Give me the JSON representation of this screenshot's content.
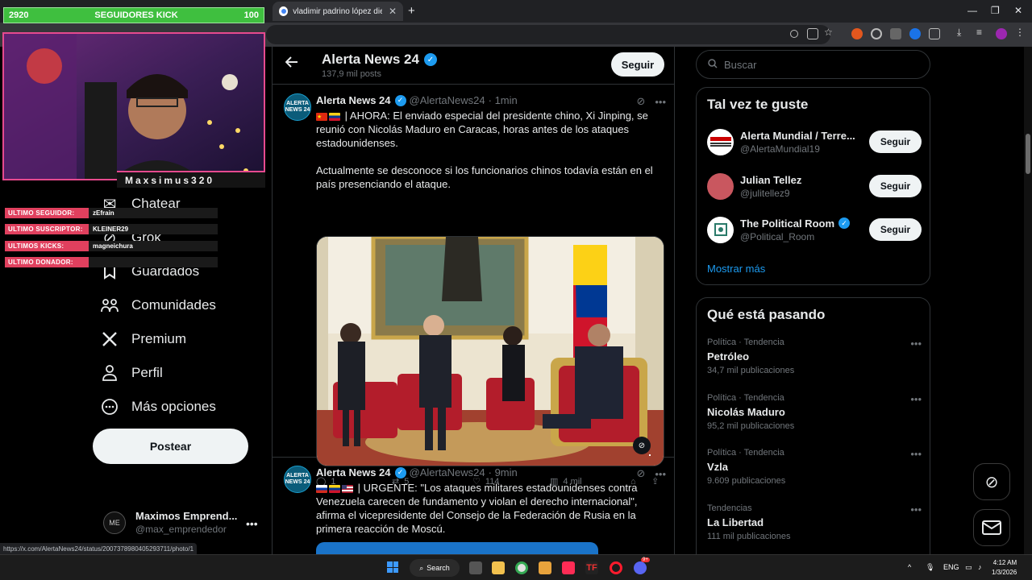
{
  "browser": {
    "active_tab_title": "vladimir padrino lópez died - G",
    "new_tab_symbol": "+",
    "url_status": "https://x.com/AlertaNews24/status/2007378980405293711/photo/1"
  },
  "stream_overlay": {
    "follower_count": "2920",
    "follower_title": "SEGUIDORES KICK",
    "follower_goal": "100",
    "streamer_name": "Maxsimus320",
    "rows": [
      {
        "label": "ULTIMO SEGUIDOR:",
        "value": "zEfrain"
      },
      {
        "label": "ULTIMO SUSCRIPTOR:",
        "value": "KLEINER29"
      },
      {
        "label": "ULTIMOS KICKS:",
        "value": "magneichura"
      },
      {
        "label": "ULTIMO DONADOR:",
        "value": ""
      }
    ]
  },
  "nav": {
    "items": [
      {
        "label": "Chatear",
        "icon": "chat-icon"
      },
      {
        "label": "Grok",
        "icon": "grok-icon"
      },
      {
        "label": "Guardados",
        "icon": "bookmark-icon"
      },
      {
        "label": "Comunidades",
        "icon": "communities-icon"
      },
      {
        "label": "Premium",
        "icon": "x-logo-icon"
      },
      {
        "label": "Perfil",
        "icon": "profile-icon"
      },
      {
        "label": "Más opciones",
        "icon": "more-options-icon"
      }
    ],
    "post_button": "Postear",
    "account": {
      "name": "Maximos Emprend...",
      "handle": "@max_emprendedor",
      "avatar_text": "ME"
    }
  },
  "profile_header": {
    "name": "Alerta News 24",
    "posts_count": "137,9 mil posts",
    "follow_label": "Seguir"
  },
  "tweets": [
    {
      "name": "Alerta News 24",
      "handle": "@AlertaNews24",
      "time": "· 1min",
      "avatar_text": "ALERTA NEWS 24",
      "text_p1": "| AHORA: El enviado especial del presidente chino, Xi Jinping, se reunió con Nicolás Maduro en Caracas, horas antes de los ataques estadounidenses.",
      "text_p2": "Actualmente se desconoce si los funcionarios chinos todavía están en el país presenciando el ataque.",
      "replies": "1",
      "reposts": "5",
      "likes": "114",
      "views": "4 mil"
    },
    {
      "name": "Alerta News 24",
      "handle": "@AlertaNews24",
      "time": "· 9min",
      "avatar_text": "ALERTA NEWS 24",
      "text_p1": "| URGENTE: \"Los ataques militares estadounidenses contra Venezuela carecen de fundamento y violan el derecho internacional\", afirma el vicepresidente del Consejo de la Federación de Rusia en la primera reacción de Moscú."
    }
  ],
  "sidebar": {
    "search_placeholder": "Buscar",
    "suggest_title": "Tal vez te guste",
    "suggestions": [
      {
        "name": "Alerta Mundial / Terre...",
        "handle": "@AlertaMundial19",
        "button": "Seguir",
        "verified": false
      },
      {
        "name": "Julian Tellez",
        "handle": "@julitellez9",
        "button": "Seguir",
        "verified": false
      },
      {
        "name": "The Political Room",
        "handle": "@Political_Room",
        "button": "Seguir",
        "verified": true
      }
    ],
    "show_more": "Mostrar más",
    "trends_title": "Qué está pasando",
    "trends": [
      {
        "category": "Política · Tendencia",
        "name": "Petróleo",
        "count": "34,7 mil publicaciones"
      },
      {
        "category": "Política · Tendencia",
        "name": "Nicolás Maduro",
        "count": "95,2 mil publicaciones"
      },
      {
        "category": "Política · Tendencia",
        "name": "Vzla",
        "count": "9.609 publicaciones"
      },
      {
        "category": "Tendencias",
        "name": "La Libertad",
        "count": "111 mil publicaciones"
      }
    ]
  },
  "taskbar": {
    "search_label": "Search",
    "language": "ENG",
    "time": "4:12 AM",
    "date": "1/3/2026",
    "badge": "9+"
  },
  "colors": {
    "accent": "#1d9bf0",
    "kick_green": "#3fbf3f",
    "overlay_pink": "#e0405e"
  }
}
